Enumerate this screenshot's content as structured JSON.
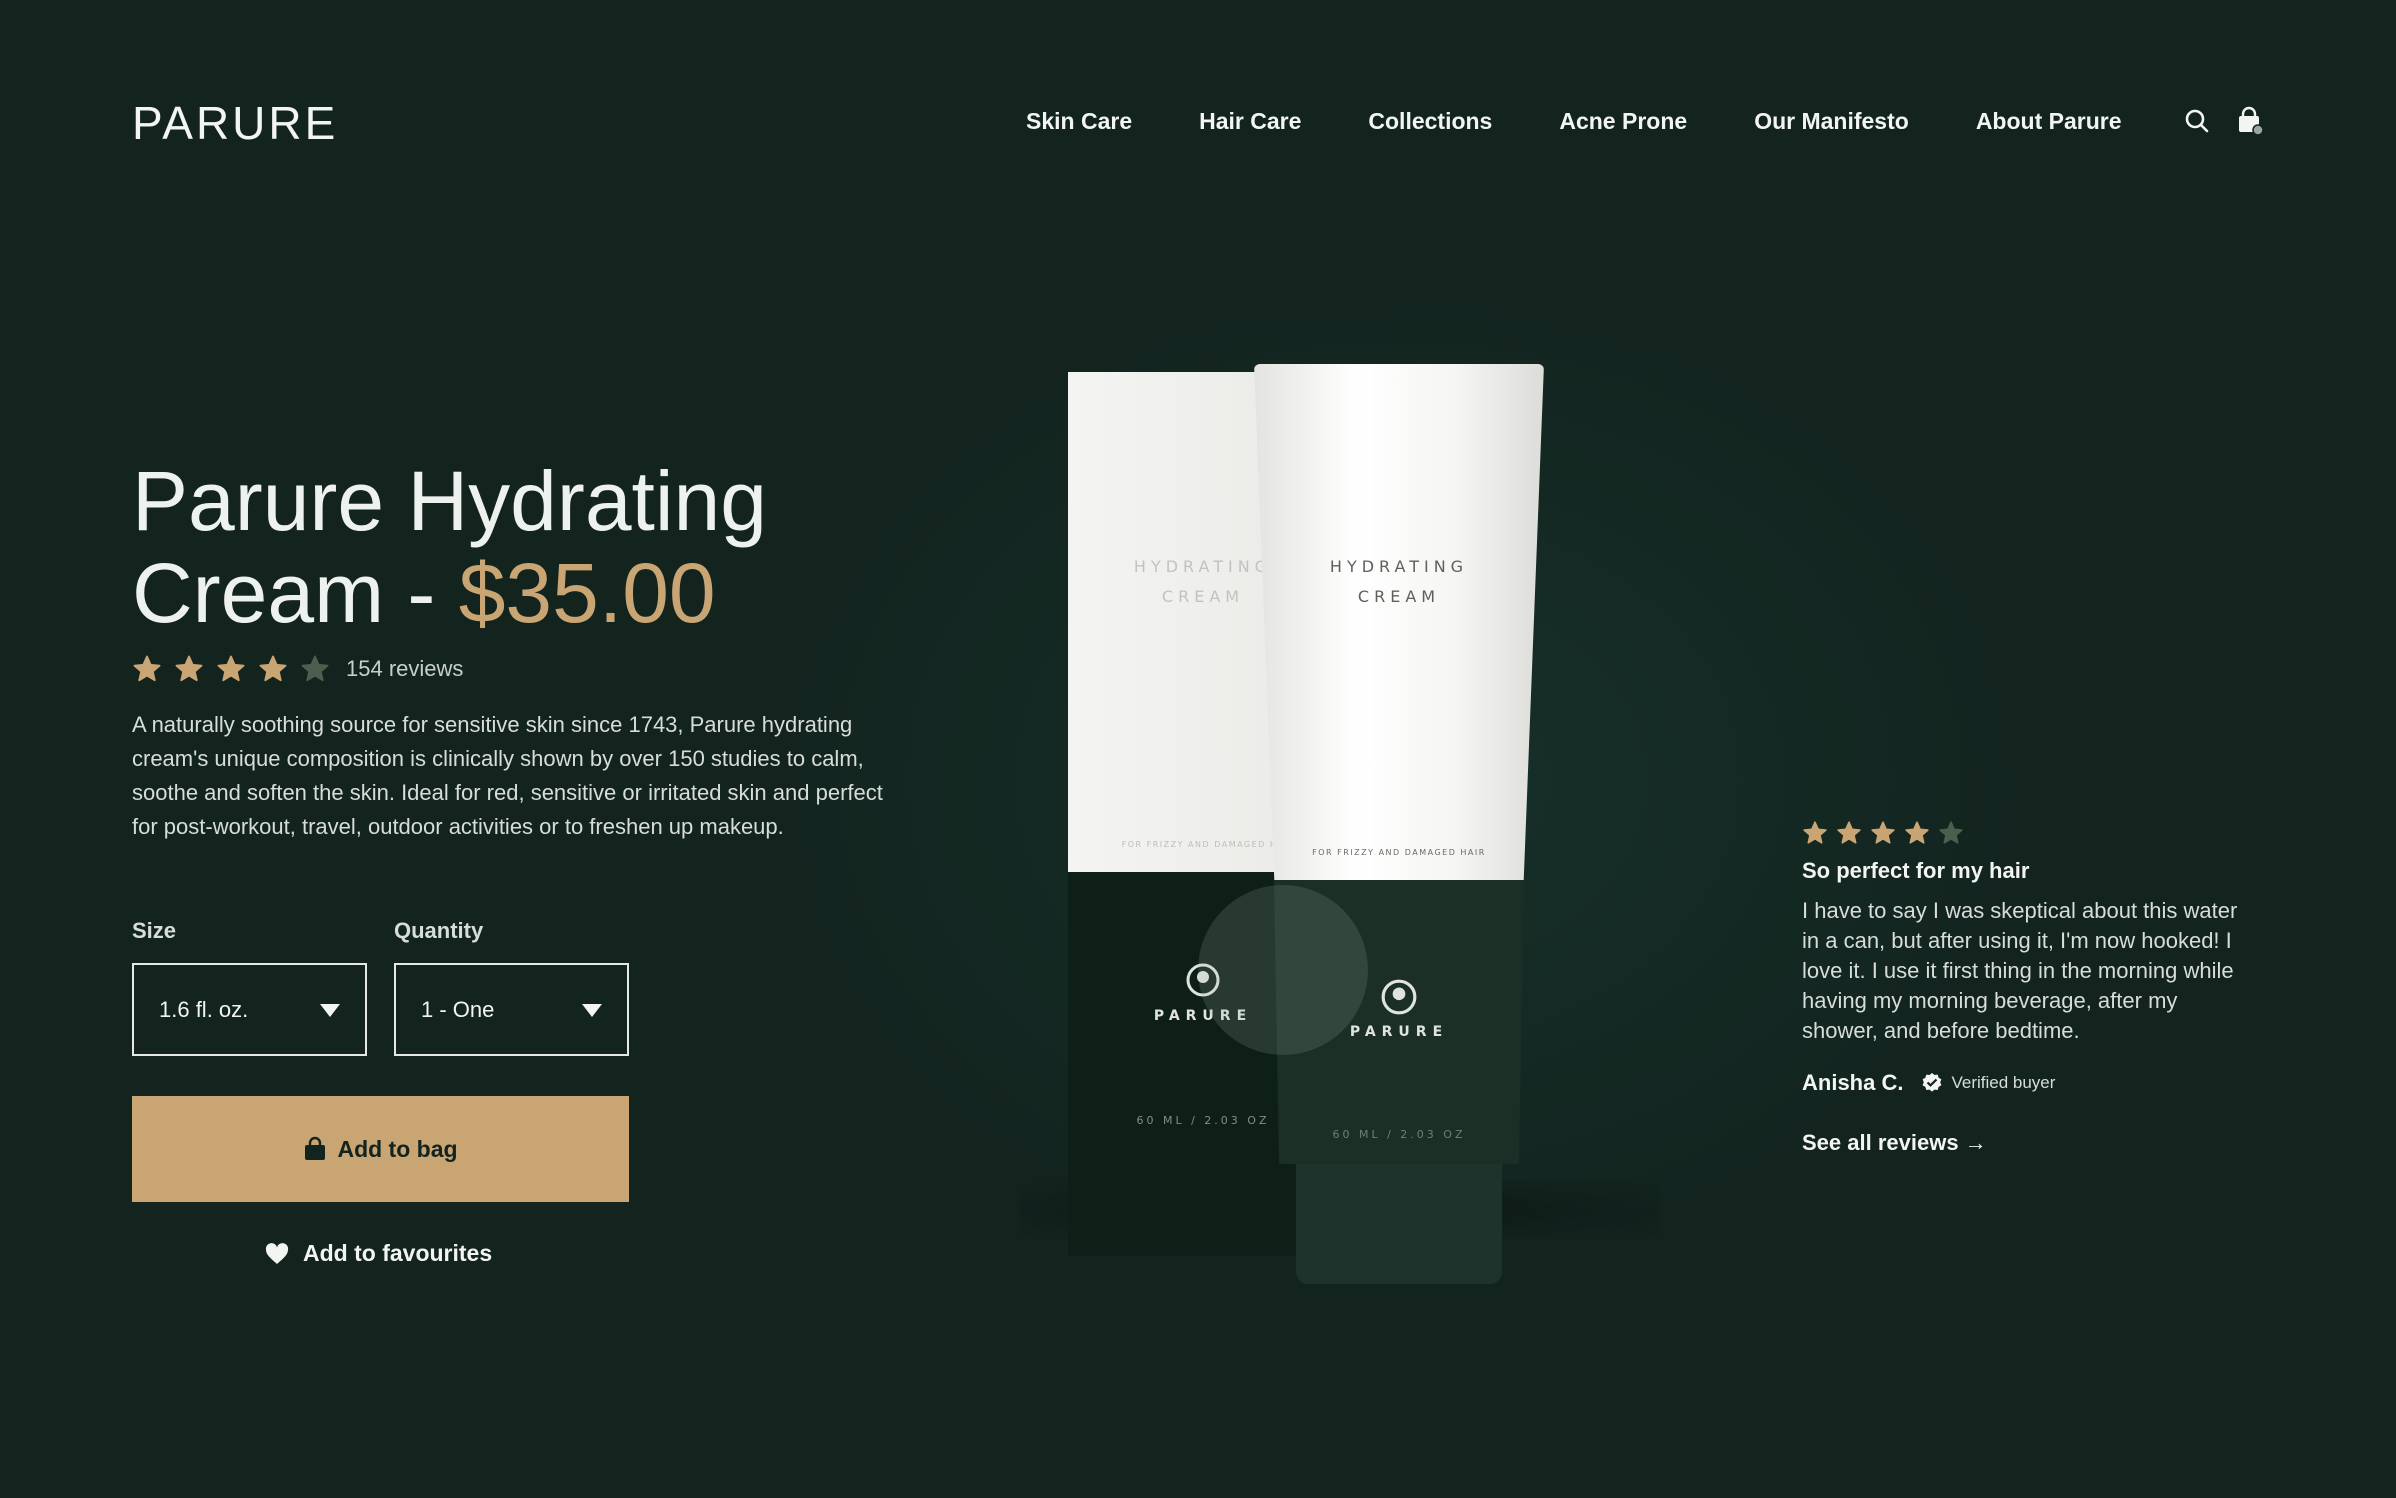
{
  "brand": {
    "logo": "PARURE"
  },
  "nav": {
    "items": [
      "Skin Care",
      "Hair Care",
      "Collections",
      "Acne Prone",
      "Our Manifesto",
      "About Parure"
    ]
  },
  "icons": {
    "search": "search-icon",
    "cart": "shopping-bag-icon"
  },
  "product": {
    "title": "Parure Hydrating Cream - ",
    "title_line1": "Parure Hydrating",
    "title_line2": "Cream - ",
    "price": "$35.00",
    "rating": 4,
    "rating_max": 5,
    "reviews_count": "154 reviews",
    "description": "A naturally soothing source for sensitive skin since 1743, Parure hydrating cream's unique composition is clinically shown by over 150 studies to calm, soothe and soften the skin. Ideal for red, sensitive or irritated skin and perfect for post-workout, travel, outdoor activities or to freshen up makeup.",
    "size_label": "Size",
    "size_value": "1.6 fl. oz.",
    "quantity_label": "Quantity",
    "quantity_value": "1 - One",
    "add_to_bag": "Add to bag",
    "add_to_favourites": "Add to favourites",
    "packaging": {
      "name_line1": "HYDRATING",
      "name_line2": "CREAM",
      "tagline": "FOR FRIZZY AND DAMAGED HAIR",
      "box_tagline": "FOR FRIZZY AND DAMAGED HA",
      "brand": "PARURE",
      "box_brand": "PARURE",
      "volume": "60 ML / 2.03 OZ"
    }
  },
  "review": {
    "rating": 4,
    "title": "So perfect for my hair",
    "body": "I have to say I was skeptical about this water in a can, but after using it, I'm now hooked! I love it.  I use it first thing in the morning while having my morning beverage, after my shower, and before bedtime.",
    "author": "Anisha C.",
    "verified": "Verified buyer",
    "see_all": "See all reviews →"
  },
  "colors": {
    "background": "#13241f",
    "accent_gold": "#c9a574",
    "star_empty": "#4c5e4e",
    "text": "#f2f5f2"
  }
}
